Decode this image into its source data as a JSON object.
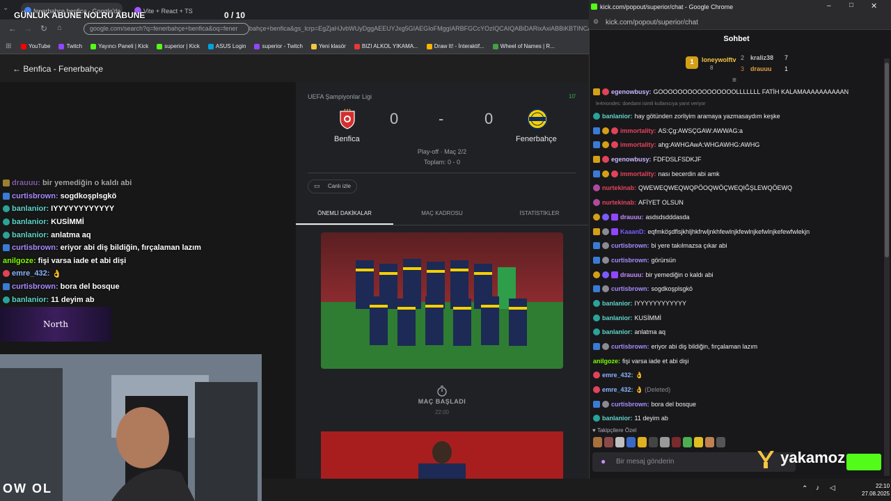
{
  "browser": {
    "tabs": [
      {
        "label": "fenerbahçe benfica - Google'da"
      },
      {
        "label": "Vite + React + TS"
      }
    ],
    "address_visible": "google.com/search?q=fenerbahçe+benfica&oq=fener",
    "address_rest": "bahçe+benfica&gs_lcrp=EgZjaHJvbWUyDggAEEUYJxg5GIAEGIoFMggIARBFGCcYOzIQCAIQABiDARixAxiABBiKBTINCAMQ"
  },
  "overlay": {
    "title": "GÜNLÜK ABUNE NOLRU ABUNE",
    "count": "0 / 10"
  },
  "bookmarks": [
    {
      "label": "YouTube",
      "color": "#ff0000"
    },
    {
      "label": "Twitch",
      "color": "#9146ff"
    },
    {
      "label": "Yayıncı Paneli | Kick",
      "color": "#53fc18"
    },
    {
      "label": "superior | Kick",
      "color": "#53fc18"
    },
    {
      "label": "ASUS Login",
      "color": "#00a3e0"
    },
    {
      "label": "superior - Twitch",
      "color": "#9146ff"
    },
    {
      "label": "Yeni klasör",
      "color": "#f5c542"
    },
    {
      "label": "BIZI ALKOL YIKAMA...",
      "color": "#e53935"
    },
    {
      "label": "Draw It! - İnteraktif...",
      "color": "#ffb300"
    },
    {
      "label": "Wheel of Names | R...",
      "color": "#43a047"
    }
  ],
  "match": {
    "back_label": "Benfica - Fenerbahçe",
    "league": "UEFA Şampiyonlar Ligi",
    "minute": "10'",
    "home": "Benfica",
    "away": "Fenerbahçe",
    "home_score": "0",
    "away_score": "0",
    "dash": "-",
    "stage": "Play-off · Maç 2/2",
    "aggregate": "Toplam: 0 - 0",
    "live_label": "Canlı izle",
    "tabs": [
      "ÖNEMLİ DAKİKALAR",
      "MAÇ KADROSU",
      "İSTATİSTİKLER"
    ],
    "started_label": "MAÇ BAŞLADI",
    "started_time": "22:00"
  },
  "overlay_chat": [
    {
      "user": "drauuu:",
      "msg": "bir yemediğin o kaldı abi",
      "color": "#c68bff"
    },
    {
      "user": "curtisbrown:",
      "msg": "sogdkoşplsgkö",
      "color": "#a78bff"
    },
    {
      "user": "banlanior:",
      "msg": "IYYYYYYYYYYYY",
      "color": "#5fd3c8"
    },
    {
      "user": "banlanior:",
      "msg": "KUSİMMİ",
      "color": "#5fd3c8"
    },
    {
      "user": "banlanior:",
      "msg": "anlatma aq",
      "color": "#5fd3c8"
    },
    {
      "user": "curtisbrown:",
      "msg": "eriyor abi diş bildiğin, fırçalaman lazım",
      "color": "#a78bff"
    },
    {
      "user": "anilgoze:",
      "msg": "fişi varsa iade et abi dişi",
      "color": "#7cfc00"
    },
    {
      "user": "emre_432:",
      "msg": "👌",
      "color": "#8ab4ff"
    },
    {
      "user": "curtisbrown:",
      "msg": "bora del bosque",
      "color": "#a78bff"
    },
    {
      "user": "banlanior:",
      "msg": "11 deyim ab",
      "color": "#5fd3c8"
    }
  ],
  "north_label": "North",
  "webcam_caption": "OW OL",
  "popup": {
    "window_title": "kick.com/popout/superior/chat - Google Chrome",
    "url": "kick.com/popout/superior/chat",
    "heading": "Sohbet",
    "leaderboard": [
      {
        "rank": "1",
        "name": "loneywolftv",
        "score": "8"
      },
      {
        "rank": "2",
        "name": "kraliz38",
        "score": "7"
      },
      {
        "rank": "3",
        "name": "drauuu",
        "score": "1"
      }
    ],
    "reply_note": "le4mondes: doedami isimli kullanıcıya yanıt veriyor",
    "messages": [
      {
        "user": "egenowbusy:",
        "text": "GOOOOOOOOOOOOOOOOLLLLLLL FATİH KALAMAAAAAAAAAAN",
        "color": "#c8b6ff"
      },
      {
        "user": "banlanior:",
        "text": "hay götünden zorliyim aramaya yazmasaydım keşke",
        "color": "#5fd3c8"
      },
      {
        "user": "immortality:",
        "text": "AS:Çg:AWSÇGAW:AWWAG:a",
        "color": "#e2435a"
      },
      {
        "user": "immortality:",
        "text": "ahg:AWHGAwA:WHGAWHG:AWHG",
        "color": "#e2435a"
      },
      {
        "user": "egenowbusy:",
        "text": "FDFDSLFSDKJF",
        "color": "#c8b6ff"
      },
      {
        "user": "immortality:",
        "text": "nası becerdin abi amk",
        "color": "#e2435a"
      },
      {
        "user": "nurtekinab:",
        "text": "QWEWEQWEQWQPÖOQWÖÇWEQIĞŞLEWQÖEWQ",
        "color": "#e2435a"
      },
      {
        "user": "nurtekinab:",
        "text": "AFİYET OLSUN",
        "color": "#e2435a"
      },
      {
        "user": "drauuu:",
        "text": "asdsdsdddasda",
        "color": "#c68bff"
      },
      {
        "user": "KaaanD:",
        "text": "eqfmköşdflsjkhljhkfrwljnkhfewlnjkfewlnjkefwlnjkefewfwlekjn",
        "color": "#7a5cff"
      },
      {
        "user": "curtisbrown:",
        "text": "bi yere takılmazsa çıkar abi",
        "color": "#a78bff"
      },
      {
        "user": "curtisbrown:",
        "text": "görürsün",
        "color": "#a78bff"
      },
      {
        "user": "drauuu:",
        "text": "bir yemediğin o kaldı abi",
        "color": "#c68bff"
      },
      {
        "user": "curtisbrown:",
        "text": "sogdkoşplsgkö",
        "color": "#a78bff"
      },
      {
        "user": "banlanior:",
        "text": "IYYYYYYYYYYYY",
        "color": "#5fd3c8"
      },
      {
        "user": "banlanior:",
        "text": "KUSİMMİ",
        "color": "#5fd3c8"
      },
      {
        "user": "banlanior:",
        "text": "anlatma aq",
        "color": "#5fd3c8"
      },
      {
        "user": "curtisbrown:",
        "text": "eriyor abi diş bildiğin, fırçalaman lazım",
        "color": "#a78bff"
      },
      {
        "user": "anilgoze:",
        "text": "fişi varsa iade et abi dişi",
        "color": "#7cfc00"
      },
      {
        "user": "emre_432:",
        "text": "👌",
        "color": "#8ab4ff"
      },
      {
        "user": "emre_432:",
        "text": "👌 (Deleted)",
        "color": "#8ab4ff"
      },
      {
        "user": "curtisbrown:",
        "text": "bora del bosque",
        "color": "#a78bff"
      },
      {
        "user": "banlanior:",
        "text": "11 deyim ab",
        "color": "#5fd3c8"
      }
    ],
    "followers_label": "Takipçilere Özel",
    "input_placeholder": "Bir mesaj gönderin",
    "brand": "yakamoz"
  },
  "taskbar": {
    "time": "22:10",
    "date": "27.08.2025"
  },
  "colors": {
    "kick_green": "#53fc18",
    "bg": "#18181b"
  }
}
